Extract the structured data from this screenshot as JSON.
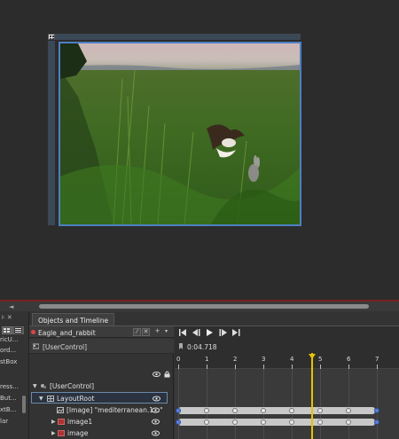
{
  "left_panel": {
    "items": [
      "ricU...",
      "ord...",
      "stBox",
      "",
      "ress...",
      "But...",
      "xtB...",
      "lar"
    ]
  },
  "panel": {
    "tab_label": "Objects and Timeline"
  },
  "storyboard": {
    "name": "Eagle_and_rabbit"
  },
  "objects": {
    "scope_label": "[UserControl]",
    "root_label": "[UserControl]",
    "tree": [
      {
        "label": "LayoutRoot"
      },
      {
        "label": "[Image] \"mediterranean.1...\""
      },
      {
        "label": "image1"
      },
      {
        "label": "image"
      }
    ]
  },
  "timeline": {
    "current_time": "0:04.718",
    "ticks": [
      "0",
      "1",
      "2",
      "3",
      "4",
      "5",
      "6",
      "7"
    ],
    "playhead_seconds": 4.718,
    "keyframe_times": [
      0,
      1,
      2,
      3,
      4,
      5,
      6,
      7
    ]
  },
  "colors": {
    "accent_blue": "#4d7fc4",
    "playhead": "#e6c200",
    "record_dot": "#dd4444"
  }
}
